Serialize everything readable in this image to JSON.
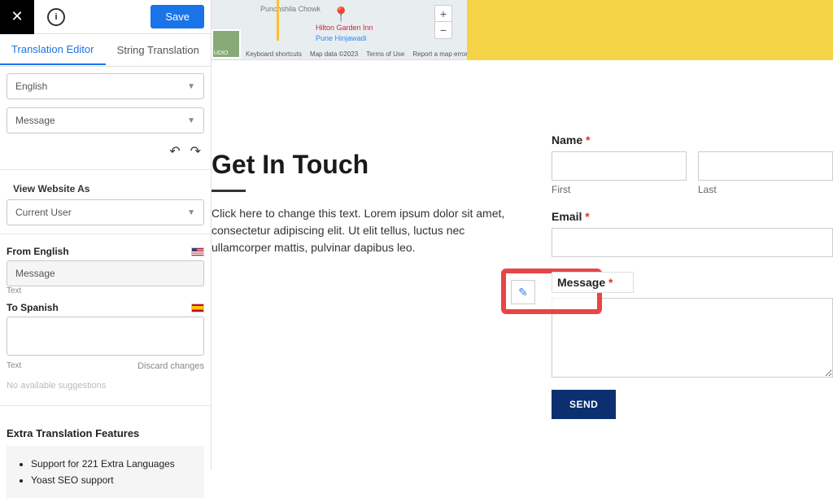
{
  "sidebar": {
    "save_label": "Save",
    "tabs": {
      "editor": "Translation Editor",
      "string": "String Translation"
    },
    "lang_select": "English",
    "item_select": "Message",
    "view_as_label": "View Website As",
    "view_as_value": "Current User",
    "from_label": "From English",
    "from_value": "Message",
    "from_type": "Text",
    "to_label": "To Spanish",
    "to_type": "Text",
    "discard": "Discard changes",
    "no_suggestions": "No available suggestions",
    "extra_title": "Extra Translation Features",
    "extra_items": [
      "Support for 221 Extra Languages",
      "Yoast SEO support"
    ]
  },
  "map": {
    "place1": "Punchshila\nChowk",
    "hotel": "Hilton Garden Inn",
    "hotel2": "Pune Hinjawadi",
    "thumb": "UDIO",
    "footer": {
      "kb": "Keyboard shortcuts",
      "data": "Map data ©2023",
      "terms": "Terms of Use",
      "report": "Report a map error"
    }
  },
  "page": {
    "heading": "Get In Touch",
    "paragraph": "Click here to change this text. Lorem ipsum dolor sit amet, consectetur adipiscing elit. Ut elit tellus, luctus nec ullamcorper mattis, pulvinar dapibus leo.",
    "form": {
      "name_label": "Name",
      "first_sub": "First",
      "last_sub": "Last",
      "email_label": "Email",
      "message_label": "Message",
      "send": "SEND"
    }
  }
}
